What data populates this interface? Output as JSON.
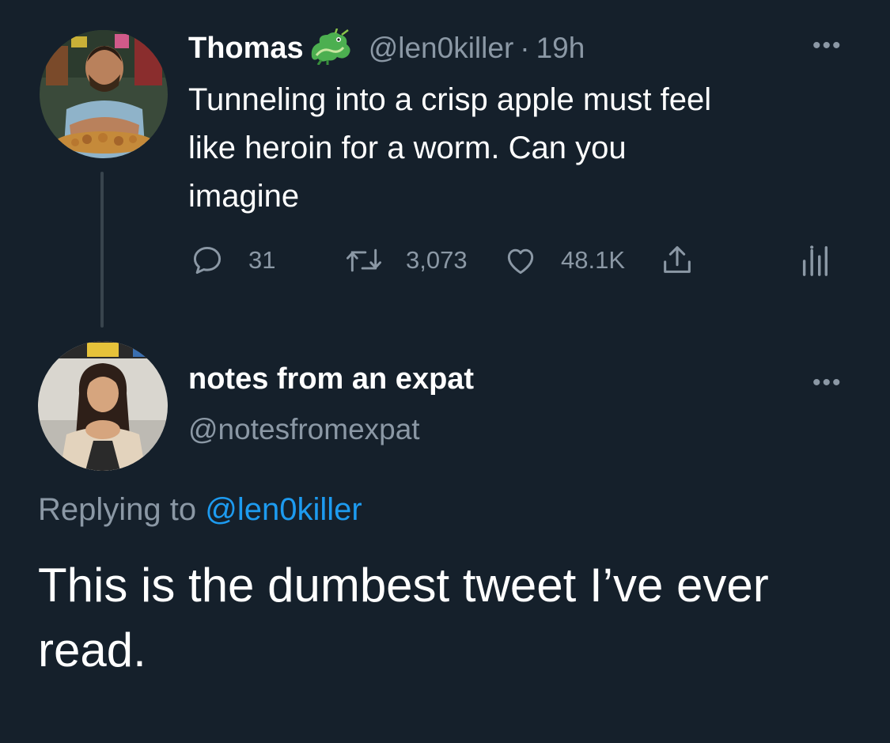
{
  "original_tweet": {
    "author_name": "Thomas",
    "emoji_icon": "dragon-emoji",
    "handle": "@len0killer",
    "separator": "·",
    "time": "19h",
    "text_lines": [
      "Tunneling into a crisp apple must feel",
      "like heroin for a worm. Can you",
      "imagine"
    ],
    "actions": {
      "reply_count": "31",
      "retweet_count": "3,073",
      "like_count": "48.1K"
    },
    "more_label": "•••"
  },
  "reply_tweet": {
    "author_name": "notes from an expat",
    "handle": "@notesfromexpat",
    "more_label": "•••",
    "replying_prefix": "Replying to",
    "replying_handle": "@len0killer",
    "text_lines": [
      "This is the dumbest tweet I’ve ever",
      "read."
    ]
  },
  "colors": {
    "background": "#15202b",
    "text_primary": "#ffffff",
    "text_secondary": "#8b98a5",
    "accent": "#1d9bf0",
    "thread_line": "#38444d"
  }
}
